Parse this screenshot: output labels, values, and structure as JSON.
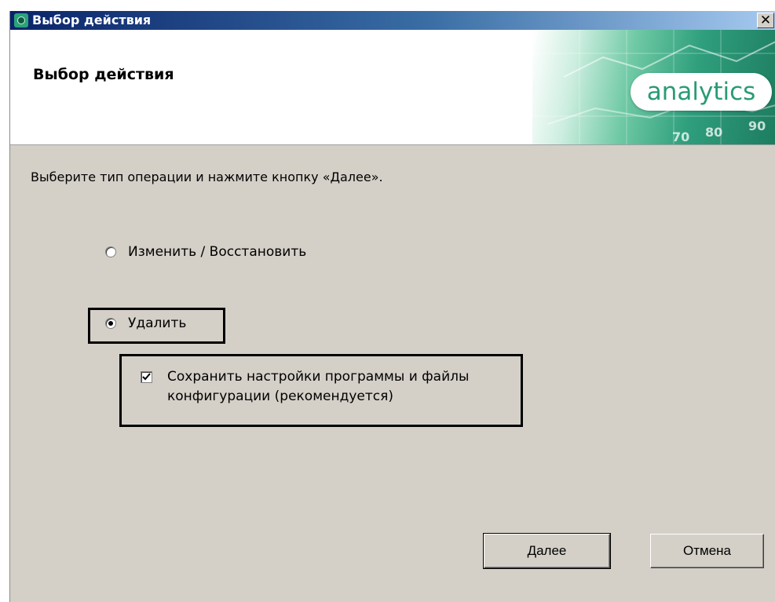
{
  "window": {
    "title": "Выбор действия",
    "close_label": "✕"
  },
  "header": {
    "title": "Выбор действия",
    "brand": "analytics",
    "banner_numbers": [
      "80",
      "90",
      "70"
    ],
    "brand_color": "#2a9b73"
  },
  "content": {
    "instruction": "Выберите тип операции и нажмите кнопку «Далее».",
    "options": [
      {
        "label": "Изменить / Восстановить",
        "selected": false
      },
      {
        "label": "Удалить",
        "selected": true
      }
    ],
    "keep_settings": {
      "label": "Сохранить настройки программы и файлы конфигурации (рекомендуется)",
      "checked": true
    }
  },
  "footer": {
    "next_label": "Далее",
    "cancel_label": "Отмена"
  },
  "icons": {
    "app": "app-icon",
    "close": "close-icon",
    "check": "check-icon"
  }
}
